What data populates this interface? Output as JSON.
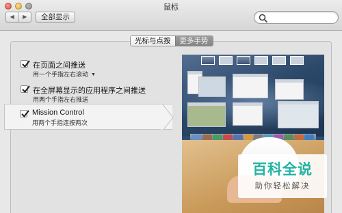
{
  "window": {
    "title": "鼠标",
    "back_glyph": "◀",
    "forward_glyph": "▶",
    "show_all_label": "全部显示",
    "search": {
      "placeholder": "",
      "value": ""
    }
  },
  "tabs": [
    {
      "label": "光标与点按",
      "active": false
    },
    {
      "label": "更多手势",
      "active": true
    }
  ],
  "options": [
    {
      "title": "在页面之间推送",
      "subtitle": "用一个手指左右滚动",
      "checked": true,
      "has_dropdown": true
    },
    {
      "title": "在全屏幕显示的应用程序之间推送",
      "subtitle": "用两个手指左右推送",
      "checked": true,
      "has_dropdown": false
    },
    {
      "title": "Mission Control",
      "subtitle": "用两个手指连按两次",
      "checked": true,
      "selected": true,
      "has_dropdown": false
    }
  ],
  "dropdown_glyph": "▼",
  "watermark": {
    "title": "百科全说",
    "subtitle": "助你轻松解决"
  },
  "colors": {
    "accent": "#1fb3a3",
    "window_bg": "#e8e8e8",
    "panel_bg": "#e2e2e2",
    "checkmark": "#1b1b1b"
  },
  "icons": {
    "search": "search-icon",
    "back": "back-arrow-icon",
    "forward": "forward-arrow-icon",
    "checkmark": "checkmark-icon"
  }
}
